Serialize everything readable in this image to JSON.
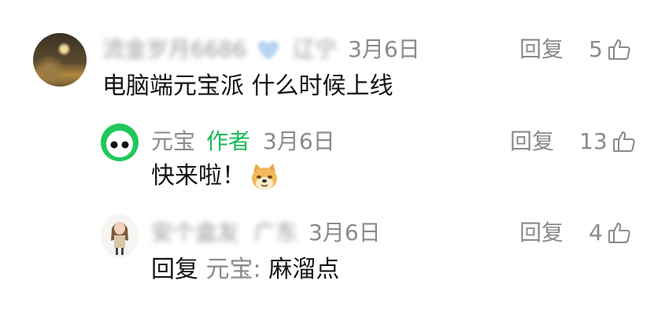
{
  "comments": [
    {
      "user": "流金岁月6686",
      "badge_icon": "heart-icon",
      "location": "辽宁",
      "date": "3月6日",
      "reply_label": "回复",
      "likes": "5",
      "text": "电脑端元宝派 什么时候上线"
    },
    {
      "user": "元宝",
      "author_tag": "作者",
      "date": "3月6日",
      "reply_label": "回复",
      "likes": "13",
      "text": "快来啦！",
      "emoji_icon": "doge-emoji-icon"
    },
    {
      "user": "安个盒友",
      "location": "广东",
      "date": "3月6日",
      "reply_label": "回复",
      "likes": "4",
      "reply_prefix": "回复",
      "reply_target": "元宝:",
      "text": "麻溜点"
    }
  ],
  "colors": {
    "author": "#19b955",
    "meta": "#8a8a8a",
    "text": "#141414",
    "brand_green": "#1fc85a"
  }
}
